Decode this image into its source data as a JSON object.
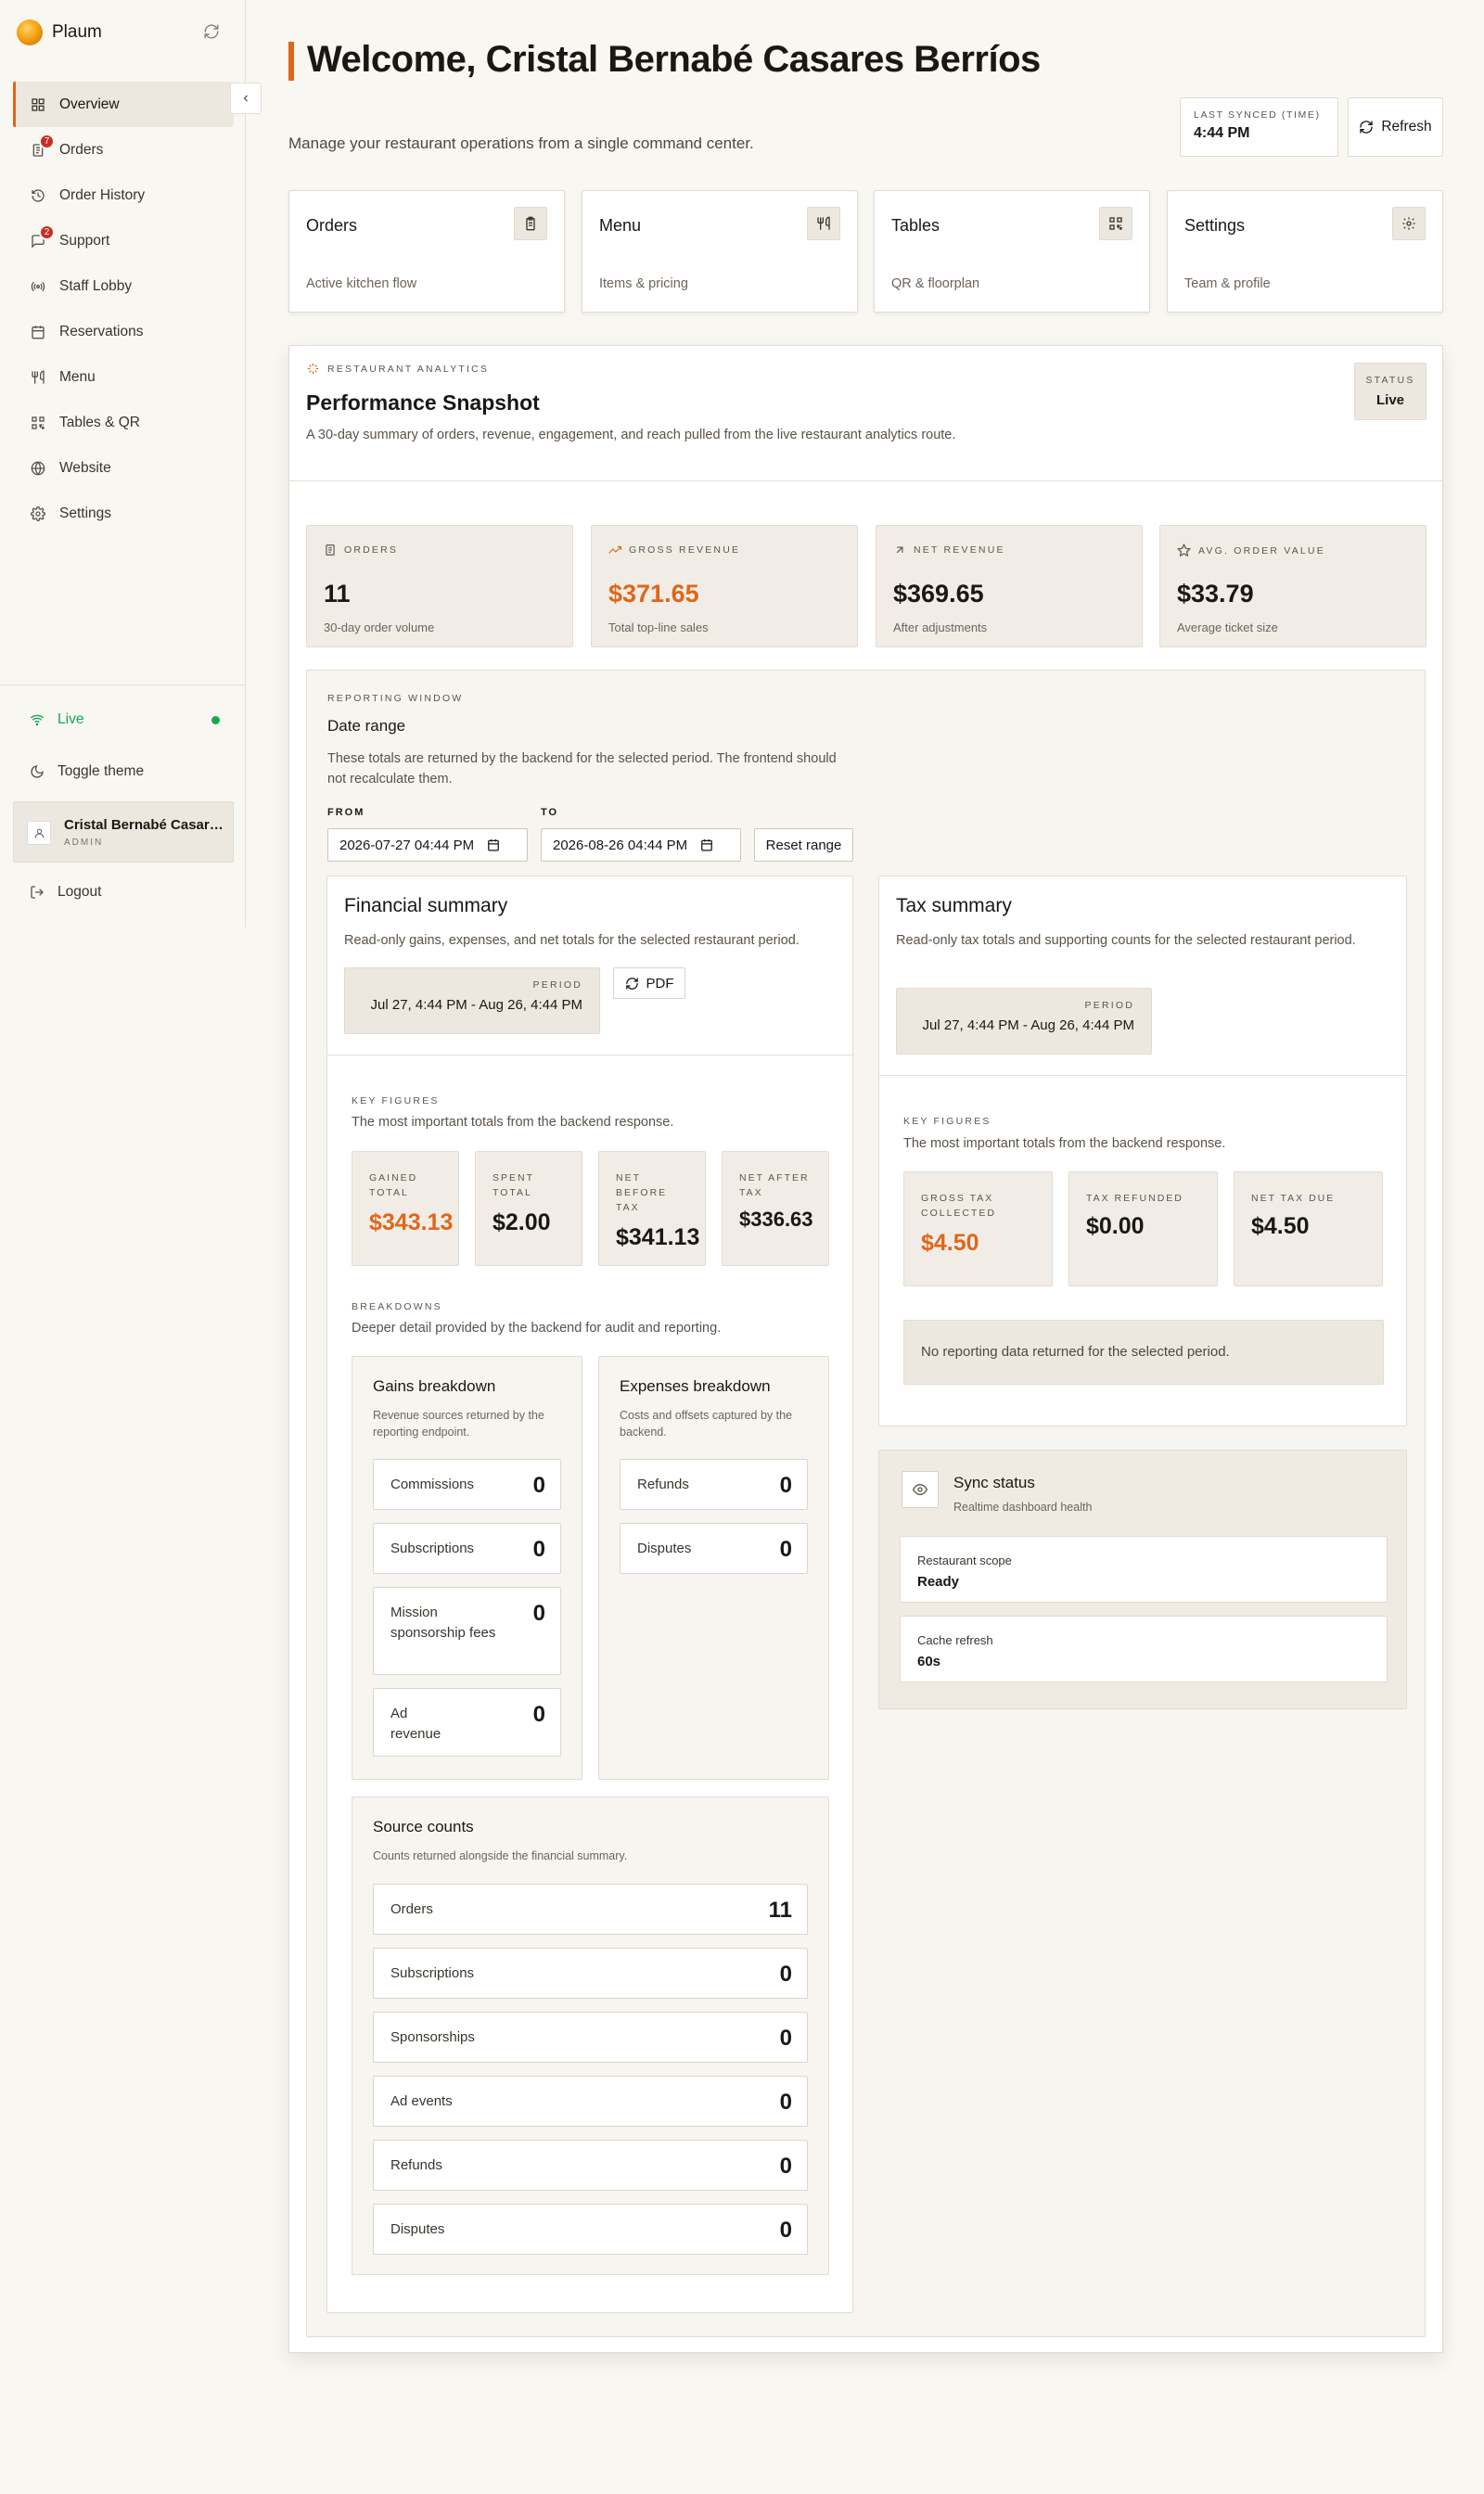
{
  "brand": {
    "name": "Plaum"
  },
  "sidebar": {
    "items": [
      {
        "label": "Overview",
        "badge": ""
      },
      {
        "label": "Orders",
        "badge": "7"
      },
      {
        "label": "Order History",
        "badge": ""
      },
      {
        "label": "Support",
        "badge": "2"
      },
      {
        "label": "Staff Lobby",
        "badge": ""
      },
      {
        "label": "Reservations",
        "badge": ""
      },
      {
        "label": "Menu",
        "badge": ""
      },
      {
        "label": "Tables & QR",
        "badge": ""
      },
      {
        "label": "Website",
        "badge": ""
      },
      {
        "label": "Settings",
        "badge": ""
      }
    ],
    "live_label": "Live",
    "theme_label": "Toggle theme",
    "user": {
      "name": "Cristal Bernabé Casares Berríos",
      "role": "ADMIN"
    },
    "logout_label": "Logout"
  },
  "header": {
    "title": "Welcome, Cristal Bernabé Casares Berríos",
    "subtitle": "Manage your restaurant operations from a single command center.",
    "sync_label": "LAST SYNCED (TIME)",
    "sync_time": "4:44 PM",
    "refresh_label": "Refresh"
  },
  "quick_cards": [
    {
      "title": "Orders",
      "subtitle": "Active kitchen flow",
      "icon": "clipboard-icon"
    },
    {
      "title": "Menu",
      "subtitle": "Items & pricing",
      "icon": "utensils-icon"
    },
    {
      "title": "Tables",
      "subtitle": "QR & floorplan",
      "icon": "qr-icon"
    },
    {
      "title": "Settings",
      "subtitle": "Team & profile",
      "icon": "gear-icon"
    }
  ],
  "analytics": {
    "eyebrow": "RESTAURANT ANALYTICS",
    "title": "Performance Snapshot",
    "description": "A 30-day summary of orders, revenue, engagement, and reach pulled from the live restaurant analytics route.",
    "status_label": "STATUS",
    "status_value": "Live",
    "stats": [
      {
        "label": "ORDERS",
        "value": "11",
        "sub": "30-day order volume",
        "icon": "receipt-icon"
      },
      {
        "label": "GROSS REVENUE",
        "value": "$371.65",
        "sub": "Total top-line sales",
        "icon": "trending-up-icon"
      },
      {
        "label": "NET REVENUE",
        "value": "$369.65",
        "sub": "After adjustments",
        "icon": "arrow-up-right-icon"
      },
      {
        "label": "AVG. ORDER VALUE",
        "value": "$33.79",
        "sub": "Average ticket size",
        "icon": "star-icon"
      }
    ]
  },
  "reporting": {
    "eyebrow": "REPORTING WINDOW",
    "title": "Date range",
    "description": "These totals are returned by the backend for the selected period. The frontend should not recalculate them.",
    "from_label": "FROM",
    "to_label": "TO",
    "from_value": "2026-07-27 04:44 PM",
    "to_value": "2026-08-26 04:44 PM",
    "reset_label": "Reset range"
  },
  "financial": {
    "title": "Financial summary",
    "description": "Read-only gains, expenses, and net totals for the selected restaurant period.",
    "period_label": "PERIOD",
    "period_value": "Jul 27, 4:44 PM - Aug 26, 4:44 PM",
    "pdf_label": "PDF",
    "key_eyebrow": "KEY FIGURES",
    "key_desc": "The most important totals from the backend response.",
    "key_figures": [
      {
        "label1": "GAINED",
        "label2": "TOTAL",
        "label3": "",
        "value": "$343.13"
      },
      {
        "label1": "SPENT",
        "label2": "TOTAL",
        "label3": "",
        "value": "$2.00"
      },
      {
        "label1": "NET",
        "label2": "BEFORE",
        "label3": "TAX",
        "value": "$341.13"
      },
      {
        "label1": "NET AFTER",
        "label2": "TAX",
        "label3": "",
        "value": "$336.63"
      }
    ],
    "breakdowns_eyebrow": "BREAKDOWNS",
    "breakdowns_desc": "Deeper detail provided by the backend for audit and reporting.",
    "gains": {
      "title": "Gains breakdown",
      "description": "Revenue sources returned by the reporting endpoint.",
      "rows": [
        {
          "label": "Commissions",
          "value": "0"
        },
        {
          "label": "Subscriptions",
          "value": "0"
        },
        {
          "label": "Mission sponsorship fees",
          "value": "0"
        },
        {
          "label": "Ad revenue",
          "value": "0"
        }
      ]
    },
    "expenses": {
      "title": "Expenses breakdown",
      "description": "Costs and offsets captured by the backend.",
      "rows": [
        {
          "label": "Refunds",
          "value": "0"
        },
        {
          "label": "Disputes",
          "value": "0"
        }
      ]
    },
    "sources": {
      "title": "Source counts",
      "description": "Counts returned alongside the financial summary.",
      "rows": [
        {
          "label": "Orders",
          "value": "11"
        },
        {
          "label": "Subscriptions",
          "value": "0"
        },
        {
          "label": "Sponsorships",
          "value": "0"
        },
        {
          "label": "Ad events",
          "value": "0"
        },
        {
          "label": "Refunds",
          "value": "0"
        },
        {
          "label": "Disputes",
          "value": "0"
        }
      ]
    }
  },
  "tax": {
    "title": "Tax summary",
    "description": "Read-only tax totals and supporting counts for the selected restaurant period.",
    "period_label": "PERIOD",
    "period_value": "Jul 27, 4:44 PM - Aug 26, 4:44 PM",
    "key_eyebrow": "KEY FIGURES",
    "key_desc": "The most important totals from the backend response.",
    "key_figures": [
      {
        "label1": "GROSS TAX",
        "label2": "COLLECTED",
        "value": "$4.50"
      },
      {
        "label1": "TAX REFUNDED",
        "label2": "",
        "value": "$0.00"
      },
      {
        "label1": "NET TAX DUE",
        "label2": "",
        "value": "$4.50"
      }
    ],
    "empty_message": "No reporting data returned for the selected period."
  },
  "sync_status": {
    "title": "Sync status",
    "description": "Realtime dashboard health",
    "rows": [
      {
        "label": "Restaurant scope",
        "value": "Ready"
      },
      {
        "label": "Cache refresh",
        "value": "60s"
      }
    ]
  },
  "colors": {
    "accent": "#e0661a",
    "live": "#1aa559",
    "badge": "#c62d24"
  }
}
